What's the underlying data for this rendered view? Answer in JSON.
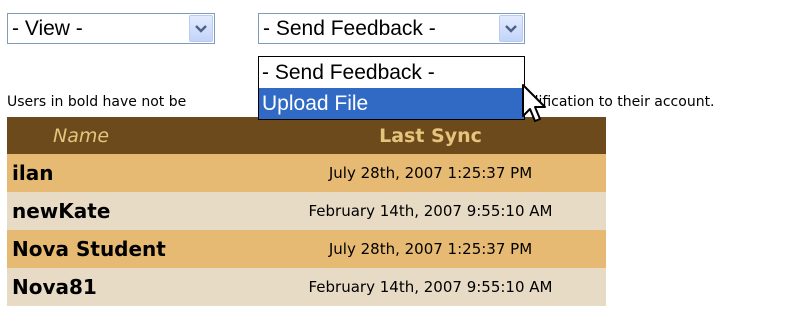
{
  "view_select": {
    "value": "- View -",
    "icon": "chevron-down-icon"
  },
  "feedback_select": {
    "value": "- Send Feedback -",
    "icon": "chevron-down-icon",
    "options": [
      "- Send Feedback -",
      "Upload File"
    ],
    "highlighted": "Upload File"
  },
  "info": {
    "text_before": "Users in bold have not be",
    "text_after": "odification to their account."
  },
  "table": {
    "headers": {
      "name": "Name",
      "last_sync": "Last Sync"
    },
    "rows": [
      {
        "name": "ilan",
        "last_sync": "July 28th, 2007 1:25:37 PM"
      },
      {
        "name": "newKate",
        "last_sync": "February 14th, 2007 9:55:10 AM"
      },
      {
        "name": "Nova Student",
        "last_sync": "July 28th, 2007 1:25:37 PM"
      },
      {
        "name": "Nova81",
        "last_sync": "February 14th, 2007 9:55:10 AM"
      }
    ]
  },
  "colors": {
    "header_bg": "#6d4a1c",
    "header_text": "#e5c47c",
    "row_odd": "#e6ba73",
    "row_even": "#e7dbc5",
    "highlight": "#316ac5"
  }
}
